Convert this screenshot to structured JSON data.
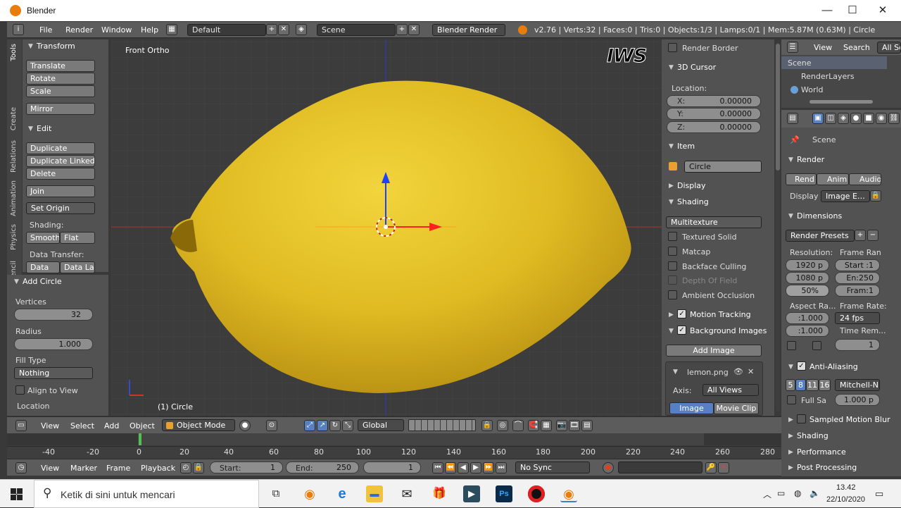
{
  "window": {
    "title": "Blender",
    "minimize": "—",
    "maximize": "☐",
    "close": "✕"
  },
  "info": {
    "menus": [
      "File",
      "Render",
      "Window",
      "Help"
    ],
    "layout": "Default",
    "scene": "Scene",
    "engine": "Blender Render",
    "stats": "v2.76 | Verts:32 | Faces:0 | Tris:0 | Objects:1/3 | Lamps:0/1 | Mem:5.87M (0.63M) | Circle"
  },
  "tool_tabs": [
    "Tools",
    "Create",
    "Relations",
    "Animation",
    "Physics",
    "Grease Pencil"
  ],
  "tools": {
    "transform_header": "Transform",
    "translate": "Translate",
    "rotate": "Rotate",
    "scale": "Scale",
    "mirror": "Mirror",
    "edit_header": "Edit",
    "duplicate": "Duplicate",
    "duplicate_linked": "Duplicate Linked",
    "delete": "Delete",
    "join": "Join",
    "set_origin": "Set Origin",
    "shading_label": "Shading:",
    "smooth": "Smooth",
    "flat": "Flat",
    "data_transfer_label": "Data Transfer:",
    "data": "Data",
    "data_lay": "Data Lay"
  },
  "operator": {
    "header": "Add Circle",
    "vertices_label": "Vertices",
    "vertices": "32",
    "radius_label": "Radius",
    "radius": "1.000",
    "fill_type_label": "Fill Type",
    "fill_type": "Nothing",
    "align_to_view": "Align to View",
    "location_label": "Location"
  },
  "viewport": {
    "view_label": "Front Ortho",
    "object_label": "(1) Circle",
    "watermark": "IWS"
  },
  "properties_n": {
    "render_border": "Render Border",
    "cursor_header": "3D Cursor",
    "location_label": "Location:",
    "x_label": "X:",
    "x": "0.00000",
    "y_label": "Y:",
    "y": "0.00000",
    "z_label": "Z:",
    "z": "0.00000",
    "item_header": "Item",
    "item_name": "Circle",
    "display_header": "Display",
    "shading_header": "Shading",
    "shading_mode": "Multitexture",
    "textured_solid": "Textured Solid",
    "matcap": "Matcap",
    "backface_culling": "Backface Culling",
    "depth_of_field": "Depth Of Field",
    "ambient_occlusion": "Ambient Occlusion",
    "motion_tracking": "Motion Tracking",
    "background_images": "Background Images",
    "add_image": "Add Image",
    "image_name": "lemon.png",
    "axis_label": "Axis:",
    "axis_value": "All Views",
    "image_tab": "Image",
    "movie_clip_tab": "Movie Clip"
  },
  "outliner": {
    "view": "View",
    "search": "Search",
    "all_scenes": "All Sc",
    "items": [
      "Scene",
      "RenderLayers",
      "World"
    ]
  },
  "render_props": {
    "scene": "Scene",
    "render_header": "Render",
    "rend": "Rend",
    "anim": "Anim",
    "audio": "Audio",
    "display_label": "Display",
    "display_value": "Image E…",
    "dimensions_header": "Dimensions",
    "render_presets": "Render Presets",
    "resolution_label": "Resolution:",
    "res_x": "1920 p",
    "res_y": "1080 p",
    "res_pct": "50%",
    "frame_range_label": "Frame Ran",
    "start": "Start :1",
    "end": "En:250",
    "frame": "Fram:1",
    "aspect_label": "Aspect Ra...",
    "aspect_x": ":1.000",
    "aspect_y": ":1.000",
    "frame_rate_label": "Frame Rate:",
    "fps": "24 fps",
    "time_remap": "Time Rem...",
    "remap_val": "1",
    "aa_header": "Anti-Aliasing",
    "aa_5": "5",
    "aa_8": "8",
    "aa_11": "11",
    "aa_16": "16",
    "aa_filter": "Mitchell-N",
    "full_sample": "Full Sa",
    "filter_size": "1.000 p",
    "sampled_motion_blur": "Sampled Motion Blur",
    "shading": "Shading",
    "performance": "Performance",
    "post_processing": "Post Processing"
  },
  "view3d_header": {
    "view": "View",
    "select": "Select",
    "add": "Add",
    "object": "Object",
    "mode": "Object Mode",
    "orientation": "Global"
  },
  "timeline": {
    "ticks": [
      "-40",
      "-20",
      "0",
      "20",
      "40",
      "60",
      "80",
      "100",
      "120",
      "140",
      "160",
      "180",
      "200",
      "220",
      "240",
      "260",
      "280"
    ],
    "view": "View",
    "marker": "Marker",
    "frame": "Frame",
    "playback": "Playback",
    "start_label": "Start:",
    "start": "1",
    "end_label": "End:",
    "end": "250",
    "current": "1",
    "sync": "No Sync"
  },
  "taskbar": {
    "search": "Ketik di sini untuk mencari",
    "time": "13.42",
    "date": "22/10/2020"
  },
  "colors": {
    "lemon": "#e3bf24",
    "viewport": "#3c3c3c",
    "accent": "#5680c2"
  }
}
